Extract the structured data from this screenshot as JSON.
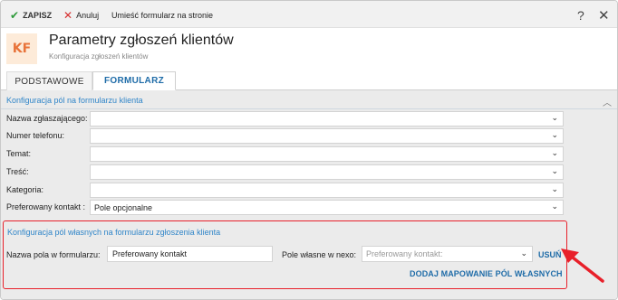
{
  "toolbar": {
    "save_label": "ZAPISZ",
    "cancel_label": "Anuluj",
    "place_label": "Umieść formularz na stronie",
    "help_label": "?",
    "close_label": "✕"
  },
  "header": {
    "icon_text": "KF",
    "title": "Parametry zgłoszeń klientów",
    "subtitle": "Konfiguracja zgłoszeń klientów"
  },
  "tabs": [
    {
      "label": "PODSTAWOWE",
      "active": false
    },
    {
      "label": "FORMULARZ",
      "active": true
    }
  ],
  "form_fields": {
    "section_title": "Konfiguracja pól na formularzu klienta",
    "rows": [
      {
        "label": "Nazwa zgłaszającego:",
        "value": ""
      },
      {
        "label": "Numer telefonu:",
        "value": ""
      },
      {
        "label": "Temat:",
        "value": ""
      },
      {
        "label": "Treść:",
        "value": ""
      },
      {
        "label": "Kategoria:",
        "value": ""
      },
      {
        "label": "Preferowany kontakt :",
        "value": "Pole opcjonalne"
      }
    ]
  },
  "custom_fields": {
    "section_title": "Konfiguracja pól własnych na formularzu zgłoszenia klienta",
    "name_label": "Nazwa pola w formularzu:",
    "name_value": "Preferowany kontakt",
    "field_label": "Pole własne w nexo:",
    "field_placeholder": "Preferowany kontakt:",
    "remove_label": "USUŃ",
    "add_label": "DODAJ MAPOWANIE PÓL WŁASNYCH"
  },
  "colors": {
    "accent": "#1f6ca8",
    "link": "#3186c9",
    "highlight": "#e8202a",
    "save_check": "#2e9a3a",
    "cancel_x": "#d62f2f",
    "logo_text": "#e8733a",
    "logo_bg": "#fdebd9"
  },
  "icons": [
    "check-icon",
    "x-icon",
    "help-icon",
    "close-icon",
    "chevron-up-icon",
    "chevron-down-icon",
    "arrow-icon"
  ]
}
